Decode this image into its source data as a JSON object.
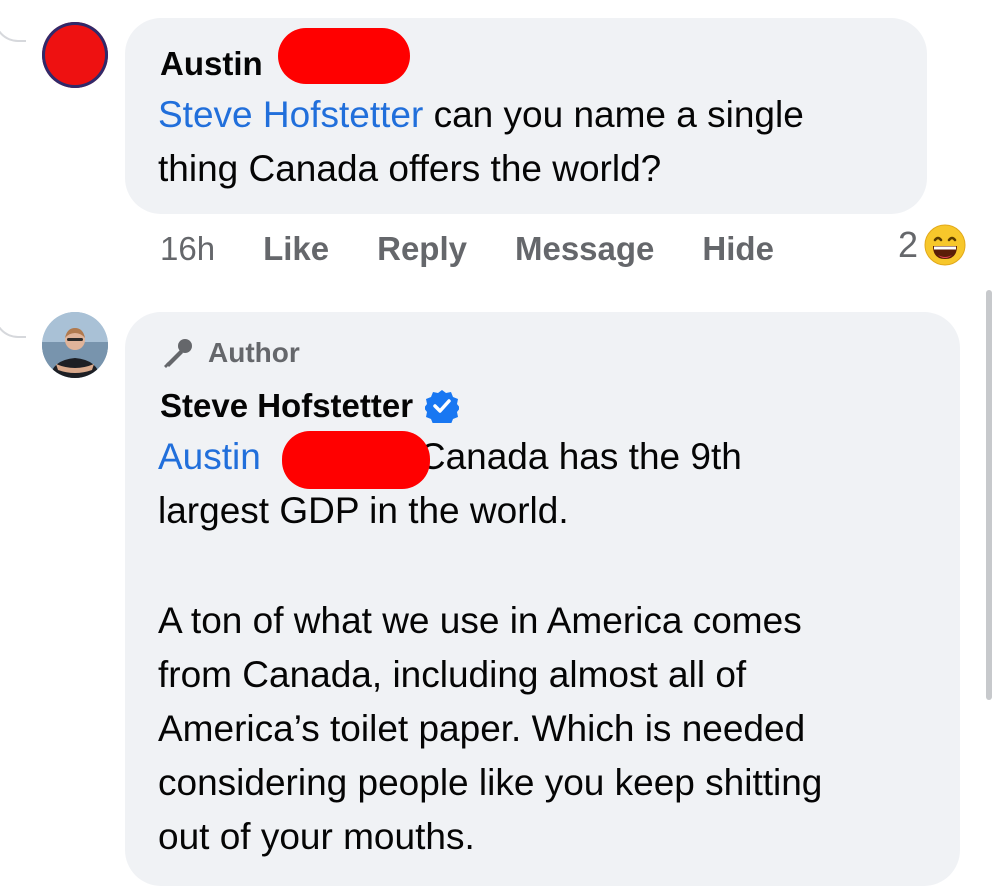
{
  "comments": [
    {
      "author": "Austin",
      "mention": "Steve Hofstetter",
      "text_line1": " can you name a single",
      "text_line2": "thing Canada offers the world?",
      "timestamp": "16h",
      "actions": [
        "Like",
        "Reply",
        "Message",
        "Hide"
      ],
      "reaction_count": "2",
      "reaction_icon": "grinning-face-icon"
    },
    {
      "badge": "Author",
      "badge_icon": "microphone-icon",
      "author": "Steve Hofstetter",
      "verified_icon": "verified-badge-icon",
      "mention": "Austin",
      "line1_rest": "Canada has the 9th",
      "line2": "largest GDP in the world.",
      "paragraph2": [
        "A ton of what we use in America comes",
        "from Canada, including almost all of",
        "America’s toilet paper. Which is needed",
        "considering people like you keep shitting",
        "out of your mouths."
      ]
    }
  ],
  "colors": {
    "mention": "#216fdb",
    "bubble": "#f0f2f5",
    "muted": "#65676b",
    "redaction": "#ff0000",
    "verified": "#1877f2"
  }
}
